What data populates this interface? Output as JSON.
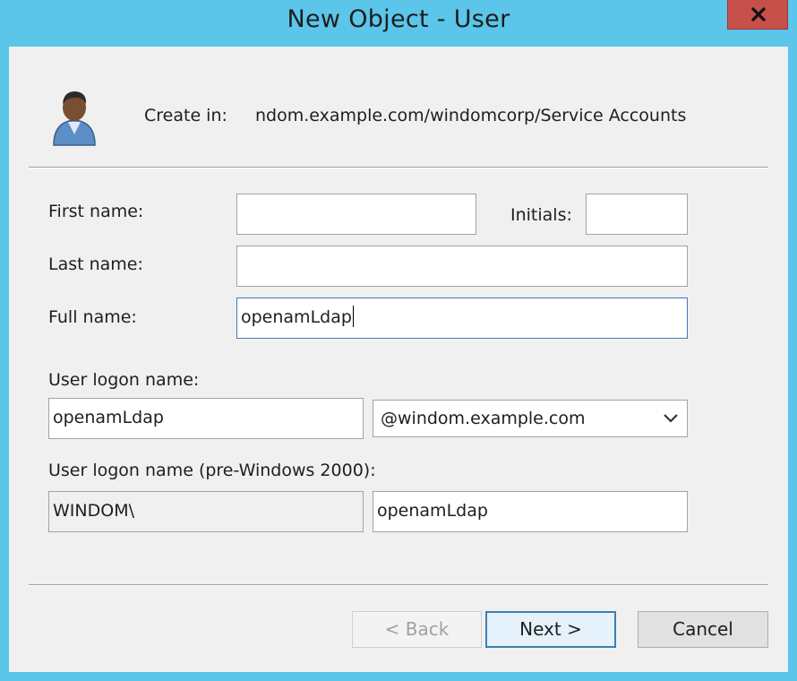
{
  "window": {
    "title": "New Object - User",
    "close_label": "x"
  },
  "header": {
    "icon": "user-icon",
    "create_in_label": "Create in:",
    "create_in_path": "ndom.example.com/windomcorp/Service Accounts"
  },
  "form": {
    "first_name": {
      "label": "First name:",
      "value": ""
    },
    "initials": {
      "label": "Initials:",
      "value": ""
    },
    "last_name": {
      "label": "Last name:",
      "value": ""
    },
    "full_name": {
      "label": "Full name:",
      "value": "openamLdap"
    },
    "logon": {
      "label": "User logon name:",
      "value": "openamLdap",
      "domain_selected": "@windom.example.com"
    },
    "pre2000": {
      "label": "User logon name (pre-Windows 2000):",
      "domain_prefix": "WINDOM\\",
      "value": "openamLdap"
    }
  },
  "buttons": {
    "back": "< Back",
    "next": "Next >",
    "cancel": "Cancel"
  }
}
